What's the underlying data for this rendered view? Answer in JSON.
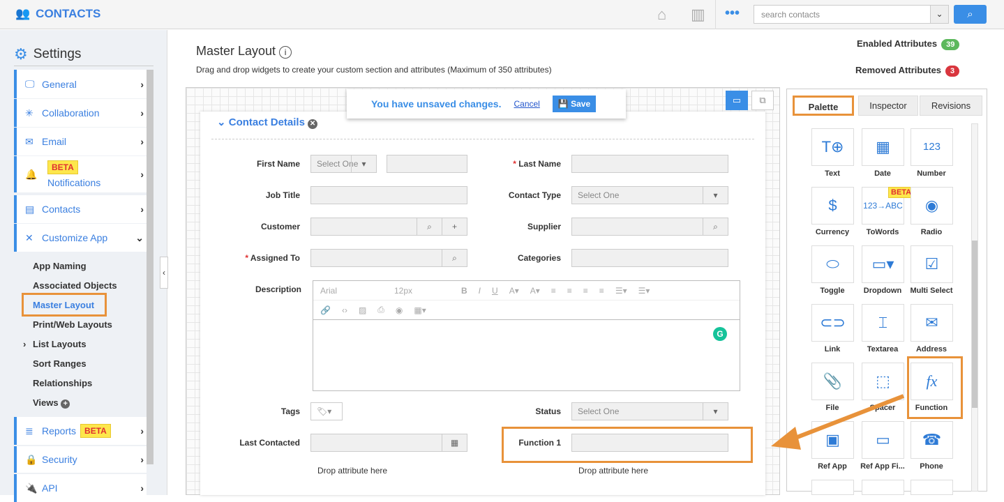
{
  "app": {
    "title": "CONTACTS",
    "search_placeholder": "search contacts",
    "icons": [
      "home-icon",
      "chart-icon",
      "more-icon",
      "search-icon"
    ]
  },
  "sidebar": {
    "title": "Settings",
    "items": [
      {
        "label": "General",
        "icon": "monitor-icon"
      },
      {
        "label": "Collaboration",
        "icon": "network-icon"
      },
      {
        "label": "Email",
        "icon": "envelope-icon"
      },
      {
        "label": "Notifications",
        "icon": "bell-icon",
        "badge": "BETA"
      },
      {
        "label": "Contacts",
        "icon": "card-icon"
      },
      {
        "label": "Customize App",
        "icon": "tools-icon"
      },
      {
        "label": "Reports",
        "icon": "report-icon",
        "badge": "BETA"
      },
      {
        "label": "Security",
        "icon": "lock-icon"
      },
      {
        "label": "API",
        "icon": "plug-icon"
      }
    ],
    "sub_items": [
      "App Naming",
      "Associated Objects",
      "Master Layout",
      "Print/Web Layouts",
      "List Layouts",
      "Sort Ranges",
      "Relationships",
      "Views"
    ],
    "active": "Master Layout"
  },
  "main": {
    "title": "Master Layout",
    "description": "Drag and drop widgets to create your custom section and attributes (Maximum of 350 attributes)",
    "enabled_label": "Enabled Attributes",
    "enabled_count": "39",
    "removed_label": "Removed Attributes",
    "removed_count": "3",
    "colors": {
      "enabled": "#5cb85c",
      "removed": "#d9363e",
      "accent": "#3a8ee6",
      "highlight": "#e8923a"
    }
  },
  "banner": {
    "message": "You have unsaved changes.",
    "cancel": "Cancel",
    "save": "Save"
  },
  "section": {
    "title": "Contact Details"
  },
  "form": {
    "first_name": "First Name",
    "select_one": "Select One",
    "last_name": "Last Name",
    "job_title": "Job Title",
    "contact_type": "Contact Type",
    "customer": "Customer",
    "supplier": "Supplier",
    "assigned_to": "Assigned To",
    "categories": "Categories",
    "description": "Description",
    "tags": "Tags",
    "status": "Status",
    "last_contacted": "Last Contacted",
    "function1": "Function 1",
    "drop": "Drop attribute here",
    "editor_font": "Arial",
    "editor_size": "12px"
  },
  "panel": {
    "tabs": [
      "Palette",
      "Inspector",
      "Revisions"
    ],
    "active_tab": "Palette",
    "widgets": [
      {
        "label": "Text",
        "icon": "T⊕"
      },
      {
        "label": "Date",
        "icon": "▦"
      },
      {
        "label": "Number",
        "icon": "123"
      },
      {
        "label": "Currency",
        "icon": "$"
      },
      {
        "label": "ToWords",
        "icon": "123→ABC",
        "badge": "BETA"
      },
      {
        "label": "Radio",
        "icon": "◉"
      },
      {
        "label": "Toggle",
        "icon": "⬭"
      },
      {
        "label": "Dropdown",
        "icon": "▭▾"
      },
      {
        "label": "Multi Select",
        "icon": "☑"
      },
      {
        "label": "Link",
        "icon": "⊂⊃"
      },
      {
        "label": "Textarea",
        "icon": "⌶"
      },
      {
        "label": "Address",
        "icon": "✉"
      },
      {
        "label": "File",
        "icon": "📎"
      },
      {
        "label": "Spacer",
        "icon": "⬚"
      },
      {
        "label": "Function",
        "icon": "fx"
      },
      {
        "label": "Ref App",
        "icon": "▣"
      },
      {
        "label": "Ref App Fi...",
        "icon": "▭"
      },
      {
        "label": "Phone",
        "icon": "☎"
      }
    ]
  }
}
